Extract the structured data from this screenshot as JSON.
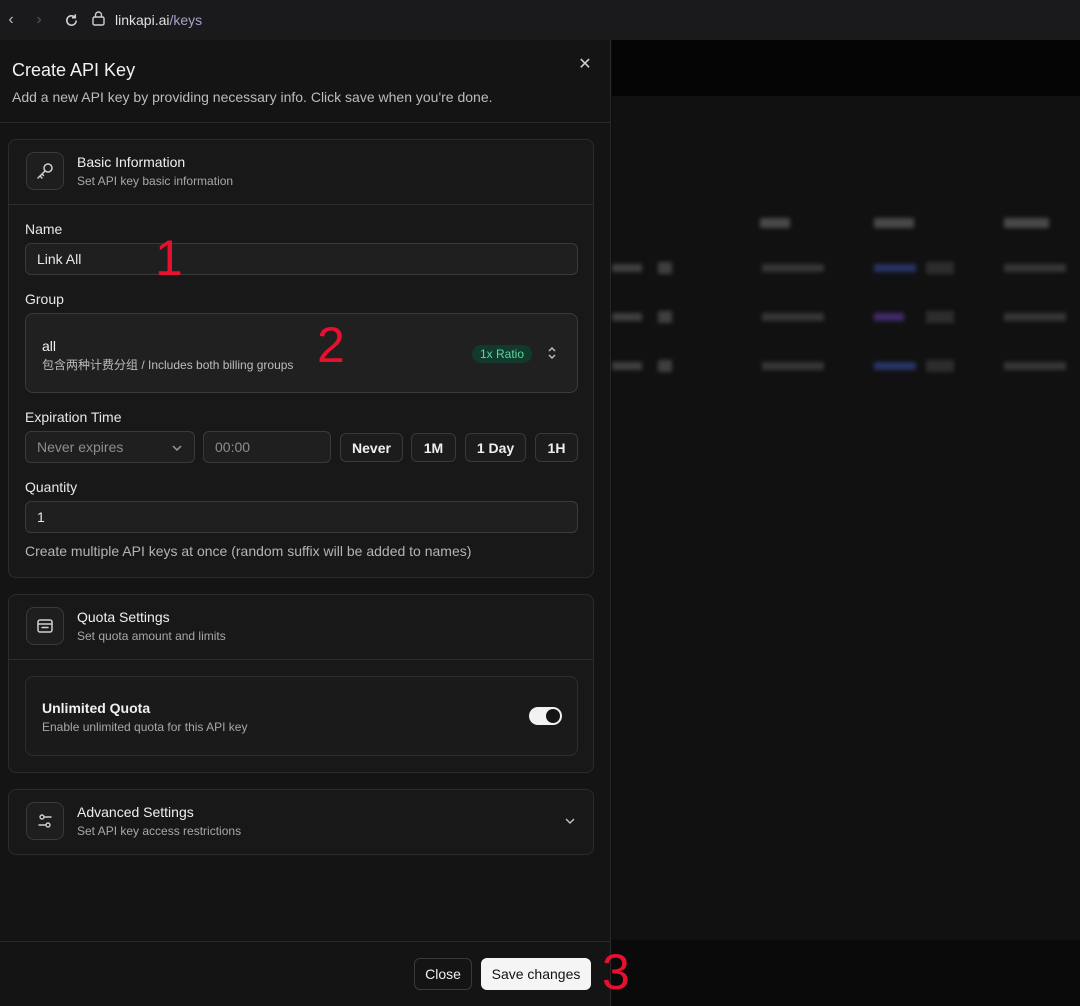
{
  "browser": {
    "host": "linkapi.ai",
    "path": "/keys"
  },
  "dialog": {
    "title": "Create API Key",
    "description": "Add a new API key by providing necessary info. Click save when you're done."
  },
  "basic": {
    "title": "Basic Information",
    "subtitle": "Set API key basic information",
    "name_label": "Name",
    "name_value": "Link All",
    "group_label": "Group",
    "group_name": "all",
    "group_desc": "包含两种计费分组 / Includes both billing groups",
    "group_ratio": "1x Ratio",
    "expiration_label": "Expiration Time",
    "expiration_select": "Never expires",
    "time_placeholder": "00:00",
    "preset_never": "Never",
    "preset_1m": "1M",
    "preset_1day": "1 Day",
    "preset_1h": "1H",
    "quantity_label": "Quantity",
    "quantity_value": "1",
    "quantity_help": "Create multiple API keys at once (random suffix will be added to names)"
  },
  "quota": {
    "title": "Quota Settings",
    "subtitle": "Set quota amount and limits",
    "unlimited_title": "Unlimited Quota",
    "unlimited_desc": "Enable unlimited quota for this API key",
    "unlimited_enabled": true
  },
  "advanced": {
    "title": "Advanced Settings",
    "subtitle": "Set API key access restrictions"
  },
  "footer": {
    "close_label": "Close",
    "save_label": "Save changes"
  },
  "annotations": {
    "n1": "1",
    "n2": "2",
    "n3": "3"
  },
  "colors": {
    "accent_ratio": "#5bd6a2",
    "annotation": "#e8102f"
  }
}
